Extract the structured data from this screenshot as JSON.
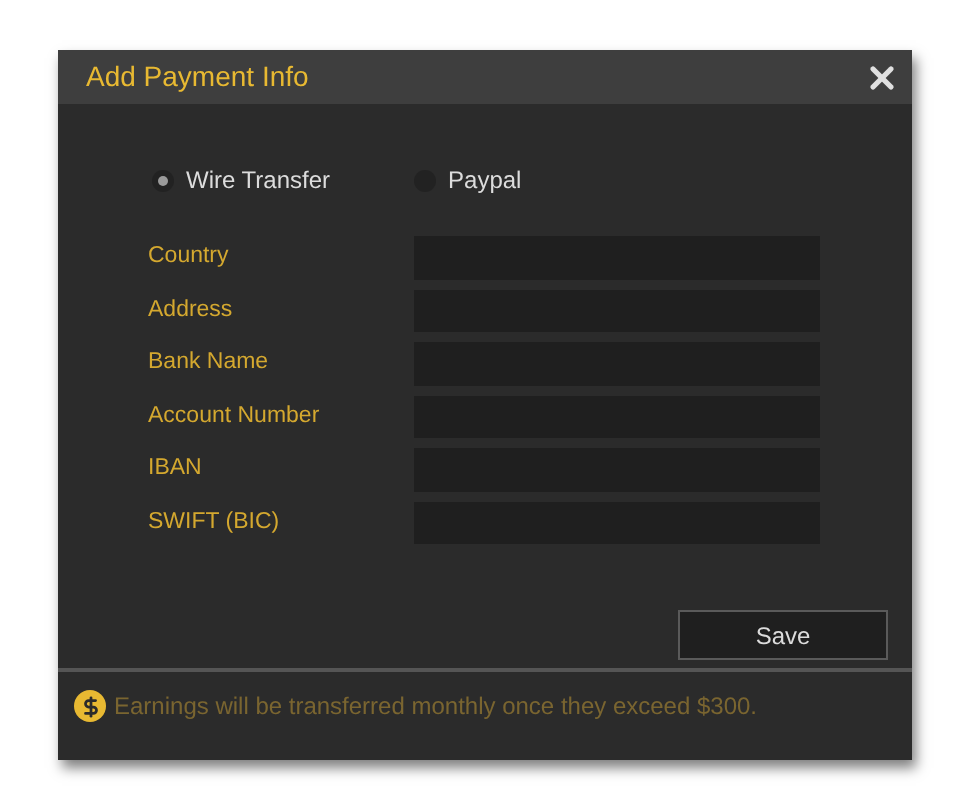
{
  "dialog": {
    "title": "Add Payment Info"
  },
  "methods": [
    {
      "label": "Wire Transfer",
      "selected": true
    },
    {
      "label": "Paypal",
      "selected": false
    }
  ],
  "fields": [
    {
      "label": "Country"
    },
    {
      "label": "Address"
    },
    {
      "label": "Bank Name"
    },
    {
      "label": "Account Number"
    },
    {
      "label": "IBAN"
    },
    {
      "label": "SWIFT (BIC)"
    }
  ],
  "save_button": "Save",
  "footer_note": "Earnings will be transferred monthly once they exceed $300."
}
